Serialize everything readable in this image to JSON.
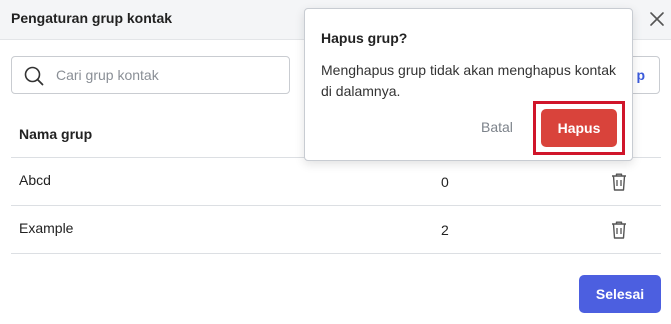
{
  "dialog": {
    "title": "Pengaturan grup kontak",
    "close_icon": "close-icon"
  },
  "search": {
    "placeholder": "Cari grup kontak",
    "icon": "search-icon"
  },
  "add_button": {
    "label": "p"
  },
  "table": {
    "columns": [
      "Nama grup"
    ],
    "rows": [
      {
        "name": "Abcd",
        "count": "0",
        "action_icon": "trash-icon"
      },
      {
        "name": "Example",
        "count": "2",
        "action_icon": "trash-icon"
      }
    ]
  },
  "footer": {
    "done_label": "Selesai"
  },
  "confirm_popover": {
    "title": "Hapus grup?",
    "message": "Menghapus grup tidak akan menghapus kontak di dalamnya.",
    "cancel_label": "Batal",
    "confirm_label": "Hapus"
  },
  "colors": {
    "primary": "#4c5fe0",
    "danger": "#d9433b",
    "highlight": "#d0152a"
  }
}
